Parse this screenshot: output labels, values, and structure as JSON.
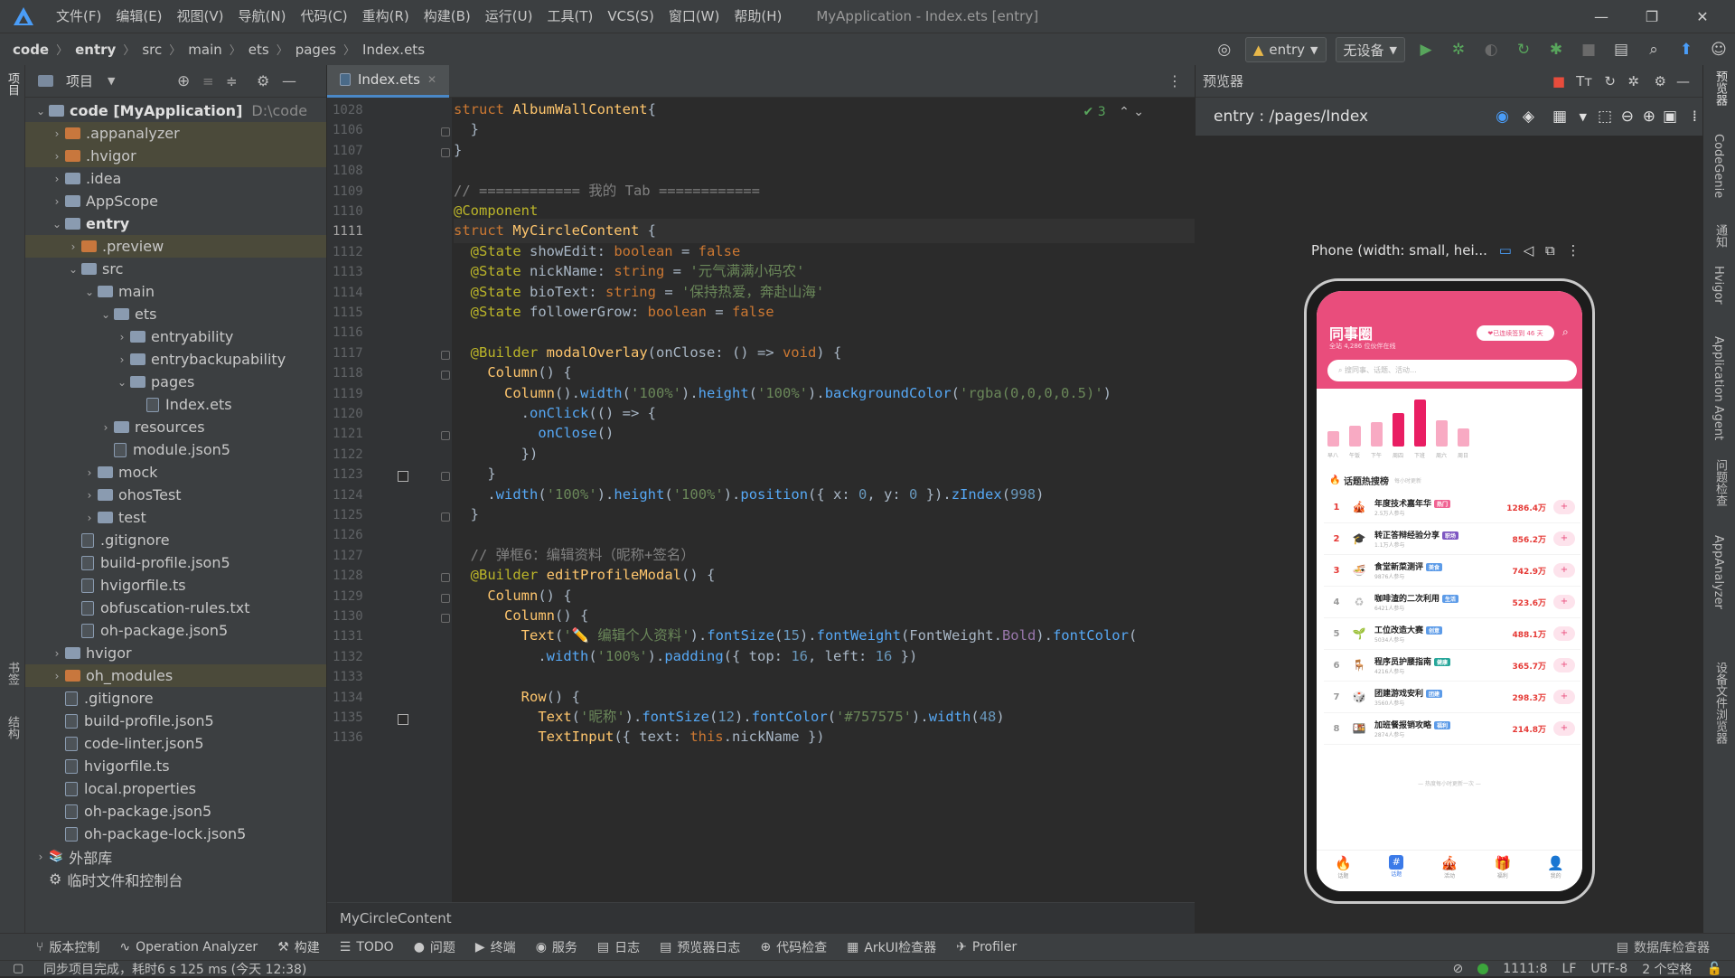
{
  "menubar": {
    "items": [
      "文件(F)",
      "编辑(E)",
      "视图(V)",
      "导航(N)",
      "代码(C)",
      "重构(R)",
      "构建(B)",
      "运行(U)",
      "工具(T)",
      "VCS(S)",
      "窗口(W)",
      "帮助(H)"
    ],
    "title": "MyApplication - Index.ets [entry]"
  },
  "navbar": {
    "breadcrumb": [
      "code",
      "entry",
      "src",
      "main",
      "ets",
      "pages",
      "Index.ets"
    ],
    "module_combo": "entry",
    "device_combo": "无设备"
  },
  "project": {
    "title": "项目",
    "tree": [
      {
        "label": "code [MyApplication]",
        "path": "D:\\code",
        "depth": 0,
        "open": true,
        "type": "folder",
        "bold_part": "code [MyApplication]"
      },
      {
        "label": ".appanalyzer",
        "depth": 1,
        "open": false,
        "type": "folder-o",
        "hl": true
      },
      {
        "label": ".hvigor",
        "depth": 1,
        "open": false,
        "type": "folder-o",
        "hl": true
      },
      {
        "label": ".idea",
        "depth": 1,
        "open": false,
        "type": "folder"
      },
      {
        "label": "AppScope",
        "depth": 1,
        "open": false,
        "type": "folder"
      },
      {
        "label": "entry",
        "depth": 1,
        "open": true,
        "type": "folder",
        "bold": true
      },
      {
        "label": ".preview",
        "depth": 2,
        "open": false,
        "type": "folder-o",
        "hl": true
      },
      {
        "label": "src",
        "depth": 2,
        "open": true,
        "type": "folder"
      },
      {
        "label": "main",
        "depth": 3,
        "open": true,
        "type": "folder"
      },
      {
        "label": "ets",
        "depth": 4,
        "open": true,
        "type": "folder"
      },
      {
        "label": "entryability",
        "depth": 5,
        "open": false,
        "type": "folder"
      },
      {
        "label": "entrybackupability",
        "depth": 5,
        "open": false,
        "type": "folder"
      },
      {
        "label": "pages",
        "depth": 5,
        "open": true,
        "type": "folder"
      },
      {
        "label": "Index.ets",
        "depth": 6,
        "type": "file"
      },
      {
        "label": "resources",
        "depth": 4,
        "open": false,
        "type": "folder"
      },
      {
        "label": "module.json5",
        "depth": 4,
        "type": "file"
      },
      {
        "label": "mock",
        "depth": 3,
        "open": false,
        "type": "folder"
      },
      {
        "label": "ohosTest",
        "depth": 3,
        "open": false,
        "type": "folder"
      },
      {
        "label": "test",
        "depth": 3,
        "open": false,
        "type": "folder"
      },
      {
        "label": ".gitignore",
        "depth": 2,
        "type": "file"
      },
      {
        "label": "build-profile.json5",
        "depth": 2,
        "type": "file"
      },
      {
        "label": "hvigorfile.ts",
        "depth": 2,
        "type": "file"
      },
      {
        "label": "obfuscation-rules.txt",
        "depth": 2,
        "type": "file"
      },
      {
        "label": "oh-package.json5",
        "depth": 2,
        "type": "file"
      },
      {
        "label": "hvigor",
        "depth": 1,
        "open": false,
        "type": "folder"
      },
      {
        "label": "oh_modules",
        "depth": 1,
        "open": false,
        "type": "folder-o",
        "hl": true
      },
      {
        "label": ".gitignore",
        "depth": 1,
        "type": "file"
      },
      {
        "label": "build-profile.json5",
        "depth": 1,
        "type": "file"
      },
      {
        "label": "code-linter.json5",
        "depth": 1,
        "type": "file"
      },
      {
        "label": "hvigorfile.ts",
        "depth": 1,
        "type": "file"
      },
      {
        "label": "local.properties",
        "depth": 1,
        "type": "file"
      },
      {
        "label": "oh-package.json5",
        "depth": 1,
        "type": "file"
      },
      {
        "label": "oh-package-lock.json5",
        "depth": 1,
        "type": "file"
      },
      {
        "label": "外部库",
        "depth": 0,
        "open": false,
        "type": "lib"
      },
      {
        "label": "临时文件和控制台",
        "depth": 0,
        "type": "console"
      }
    ]
  },
  "editor": {
    "tab": "Index.ets",
    "check_count": "3",
    "footer": "MyCircleContent",
    "current_line": "1111",
    "line_numbers": [
      "1028",
      "1106",
      "1107",
      "1108",
      "1109",
      "1110",
      "1111",
      "1112",
      "1113",
      "1114",
      "1115",
      "1116",
      "1117",
      "1118",
      "1119",
      "1120",
      "1121",
      "1122",
      "1123",
      "1124",
      "1125",
      "1126",
      "1127",
      "1128",
      "1129",
      "1130",
      "1131",
      "1132",
      "1133",
      "1134",
      "1135",
      "1136"
    ]
  },
  "left_strip": {
    "top": "项目",
    "mid": "书签",
    "bot": "结构"
  },
  "preview": {
    "title": "预览器",
    "route": "entry : /pages/Index",
    "device": "Phone (width: small, hei...",
    "app": {
      "title": "同事圈",
      "subtitle": "全站 4,286 位伙伴在线",
      "badge": "已连续签到 46 天",
      "search": "搜同事、话题、活动...",
      "rank_title": "话题热搜榜",
      "rank_sub": "每小时更新",
      "rows": [
        {
          "n": "1",
          "name": "年度技术嘉年华",
          "tag": "热门",
          "tagc": "#f06292",
          "sub": "2.5万人参与",
          "val": "1286.4万",
          "emo": "🎪"
        },
        {
          "n": "2",
          "name": "转正答辩经验分享",
          "tag": "职场",
          "tagc": "#7e57c2",
          "sub": "1.1万人参与",
          "val": "856.2万",
          "emo": "🎓"
        },
        {
          "n": "3",
          "name": "食堂新菜测评",
          "tag": "美食",
          "tagc": "#5c9be8",
          "sub": "9876人参与",
          "val": "742.9万",
          "emo": "🍜"
        },
        {
          "n": "4",
          "name": "咖啡渣的二次利用",
          "tag": "生活",
          "tagc": "#5c9be8",
          "sub": "6421人参与",
          "val": "523.6万",
          "emo": "♻"
        },
        {
          "n": "5",
          "name": "工位改造大赛",
          "tag": "创意",
          "tagc": "#5c9be8",
          "sub": "5034人参与",
          "val": "488.1万",
          "emo": "🌱"
        },
        {
          "n": "6",
          "name": "程序员护腰指南",
          "tag": "健康",
          "tagc": "#26a69a",
          "sub": "4216人参与",
          "val": "365.7万",
          "emo": "🪑"
        },
        {
          "n": "7",
          "name": "团建游戏安利",
          "tag": "团建",
          "tagc": "#5c9be8",
          "sub": "3560人参与",
          "val": "298.3万",
          "emo": "🎲"
        },
        {
          "n": "8",
          "name": "加班餐报销攻略",
          "tag": "福利",
          "tagc": "#5c9be8",
          "sub": "2874人参与",
          "val": "214.8万",
          "emo": "🍱"
        }
      ],
      "end": "— 热度每小时更新一次 —",
      "tabs": [
        {
          "l": "话题",
          "ic": "🔥"
        },
        {
          "l": "话题",
          "ic": "#",
          "on": true
        },
        {
          "l": "活动",
          "ic": "🎪"
        },
        {
          "l": "福利",
          "ic": "🎁"
        },
        {
          "l": "我的",
          "ic": "👤"
        }
      ],
      "bars": [
        {
          "h": 0.28,
          "lbl": "早八"
        },
        {
          "h": 0.38,
          "lbl": "午饭"
        },
        {
          "h": 0.45,
          "lbl": "下午"
        },
        {
          "h": 0.62,
          "hot": true,
          "lbl": "周四"
        },
        {
          "h": 0.86,
          "hot": true,
          "lbl": "下班"
        },
        {
          "h": 0.48,
          "lbl": "周六"
        },
        {
          "h": 0.34,
          "lbl": "周日"
        }
      ]
    }
  },
  "right_strip": [
    "预览器",
    "CodeGenie",
    "通知",
    "Hvigor",
    "Application Agent",
    "问题检查",
    "AppAnalyzer",
    "设备文件浏览器"
  ],
  "toolwindows": [
    "版本控制",
    "Operation Analyzer",
    "构建",
    "TODO",
    "问题",
    "终端",
    "服务",
    "日志",
    "预览器日志",
    "代码检查",
    "ArkUI检查器",
    "Profiler"
  ],
  "toolwin_right": "数据库检查器",
  "status": {
    "msg": "同步项目完成，耗时6 s 125 ms (今天 12:38)",
    "pos": "1111:8",
    "eol": "LF",
    "enc": "UTF-8",
    "indent": "2 个空格"
  }
}
